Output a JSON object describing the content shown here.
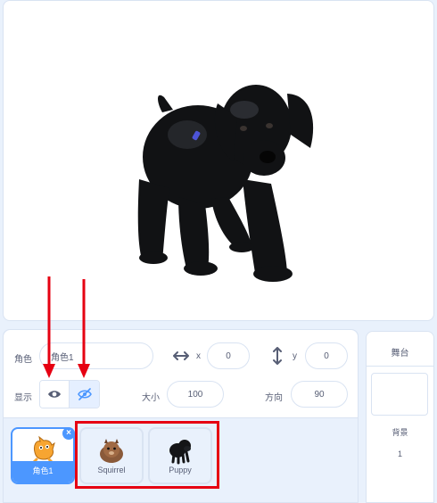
{
  "sprite_info": {
    "sprite_label": "角色",
    "sprite_name": "角色1",
    "x_label": "x",
    "x_value": "0",
    "y_label": "y",
    "y_value": "0",
    "show_label": "显示",
    "size_label": "大小",
    "size_value": "100",
    "direction_label": "方向",
    "direction_value": "90",
    "visibility": "hidden"
  },
  "sprites": [
    {
      "name": "角色1",
      "icon": "scratch-cat-icon",
      "selected": true
    },
    {
      "name": "Squirrel",
      "icon": "squirrel-icon",
      "selected": false
    },
    {
      "name": "Puppy",
      "icon": "puppy-icon",
      "selected": false
    }
  ],
  "stage_panel": {
    "title": "舞台",
    "backdrop_label": "背景",
    "backdrop_count": "1"
  },
  "colors": {
    "accent": "#4c97ff",
    "annotation": "#e60012",
    "panel_bg": "#e9f1fc"
  }
}
